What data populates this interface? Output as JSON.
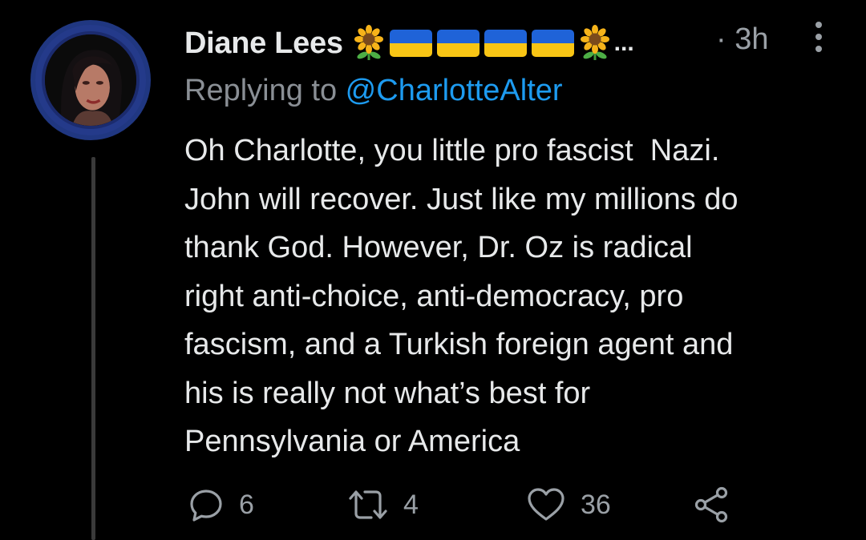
{
  "author": {
    "display_name": "Diane Lees",
    "name_suffix": "...",
    "name_emojis": [
      "sunflower-icon",
      "ukraine-flag-icon",
      "ukraine-flag-icon",
      "ukraine-flag-icon",
      "ukraine-flag-icon",
      "sunflower-icon"
    ]
  },
  "timestamp": "· 3h",
  "reply": {
    "prefix": "Replying to ",
    "handle": "@CharlotteAlter"
  },
  "body_lines": [
    "Oh Charlotte, you little pro fascist  Nazi.",
    "John will recover. Just like my millions do",
    "thank God. However, Dr. Oz is radical",
    "right anti-choice, anti-democracy, pro",
    "fascism, and a Turkish foreign agent and",
    "his is really not what’s best for",
    "Pennsylvania or America"
  ],
  "actions": {
    "reply_count": "6",
    "retweet_count": "4",
    "like_count": "36"
  },
  "colors": {
    "background": "#000000",
    "text": "#e7e9ea",
    "muted": "#8a8f95",
    "link": "#1d9bf0",
    "avatar_ring": "#203781",
    "flag_blue": "#1f63d8",
    "flag_yellow": "#f8c515"
  }
}
